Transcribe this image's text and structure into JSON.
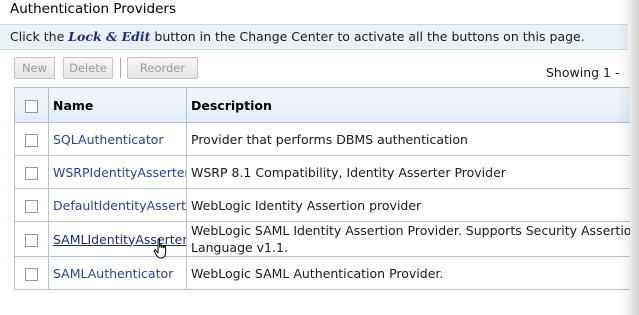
{
  "panel": {
    "title": "Authentication Providers"
  },
  "info": {
    "prefix": "Click the ",
    "highlight": "Lock & Edit",
    "suffix": " button in the Change Center to activate all the buttons on this page."
  },
  "toolbar": {
    "new_label": "New",
    "delete_label": "Delete",
    "reorder_label": "Reorder"
  },
  "pagination": {
    "showing_text": "Showing 1 -"
  },
  "table": {
    "columns": {
      "name": "Name",
      "description": "Description"
    },
    "rows": [
      {
        "name": "SQLAuthenticator",
        "description": "Provider that performs DBMS authentication"
      },
      {
        "name": "WSRPIdentityAsserter",
        "description": "WSRP 8.1 Compatibility, Identity Asserter Provider"
      },
      {
        "name": "DefaultIdentityAsserter",
        "description": "WebLogic Identity Assertion provider"
      },
      {
        "name": "SAMLIdentityAsserter",
        "description_line1": "WebLogic SAML Identity Assertion Provider. Supports Security Assertion Mar",
        "description_line2": "Language v1.1."
      },
      {
        "name": "SAMLAuthenticator",
        "description": "WebLogic SAML Authentication Provider."
      }
    ]
  },
  "colors": {
    "link": "#2b3fa0",
    "header_bg": "#e1ebf5",
    "info_bg": "#eaf1f8",
    "border": "#b6c2cf"
  },
  "icons": {
    "cursor": "hand-pointer-icon"
  }
}
